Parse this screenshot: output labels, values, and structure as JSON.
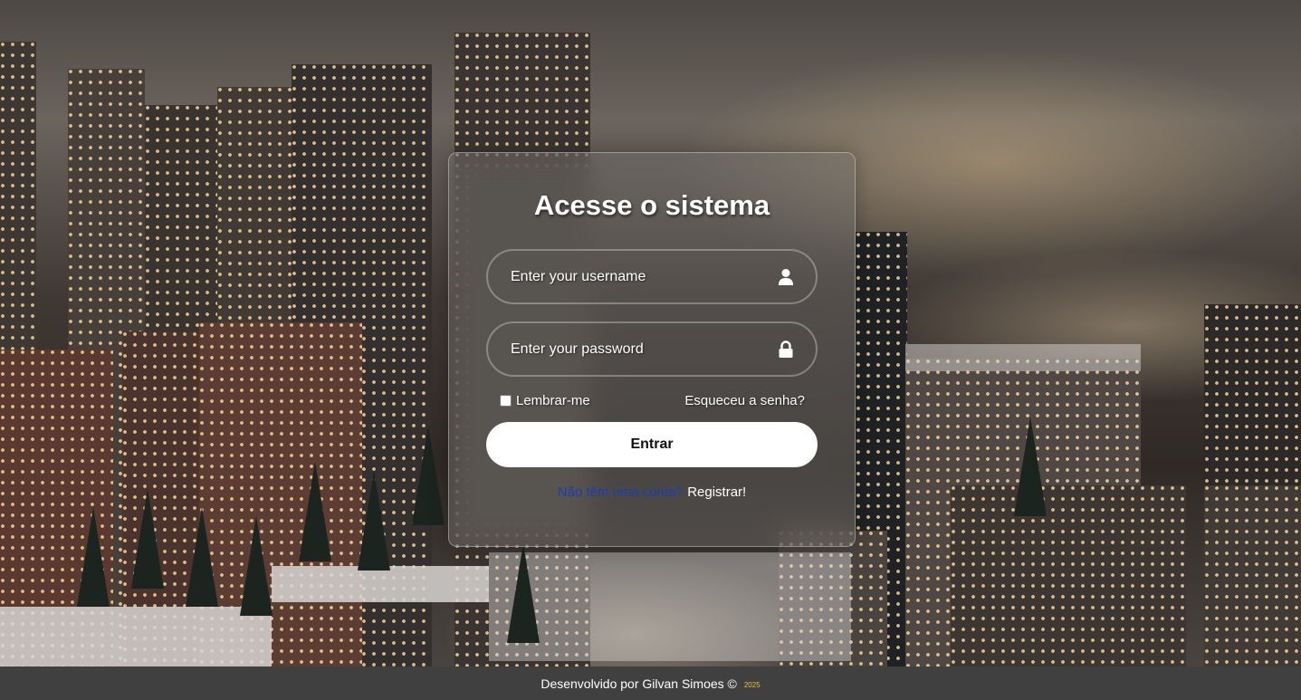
{
  "login": {
    "title": "Acesse o sistema",
    "username_placeholder": "Enter your username",
    "password_placeholder": "Enter your password",
    "remember_label": "Lembrar-me",
    "forgot_label": "Esqueceu a senha?",
    "submit_label": "Entrar",
    "register_question": "Não têm uma conta?",
    "register_link": "Registrar!",
    "username_icon": "user-icon",
    "password_icon": "lock-icon"
  },
  "footer": {
    "text": "Desenvolvido por Gilvan Simoes ©",
    "year": "2025"
  },
  "colors": {
    "footer_bg": "#404040",
    "register_question": "#1a3fb0",
    "year": "#f0c030",
    "button_bg": "#ffffff"
  }
}
